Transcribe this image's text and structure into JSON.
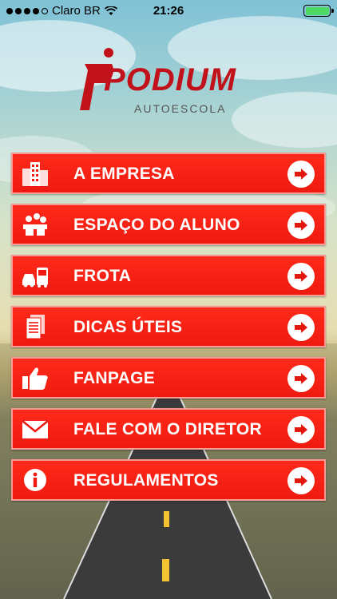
{
  "status_bar": {
    "carrier": "Claro BR",
    "time": "21:26",
    "signal_bars": 4,
    "battery_level": 1.0
  },
  "logo": {
    "wordmark": "PODIUM",
    "subtitle": "AUTOESCOLA"
  },
  "colors": {
    "button_red": "#ff2a1a",
    "brand_red": "#c1121b",
    "battery_green": "#4cd964"
  },
  "menu": {
    "items": [
      {
        "label": "A EMPRESA",
        "icon": "buildings-icon"
      },
      {
        "label": "ESPAÇO DO ALUNO",
        "icon": "students-icon"
      },
      {
        "label": "FROTA",
        "icon": "car-bus-icon"
      },
      {
        "label": "DICAS ÚTEIS",
        "icon": "documents-icon"
      },
      {
        "label": "FANPAGE",
        "icon": "thumbs-up-icon"
      },
      {
        "label": "FALE COM O DIRETOR",
        "icon": "envelope-icon"
      },
      {
        "label": "REGULAMENTOS",
        "icon": "info-icon"
      }
    ]
  }
}
